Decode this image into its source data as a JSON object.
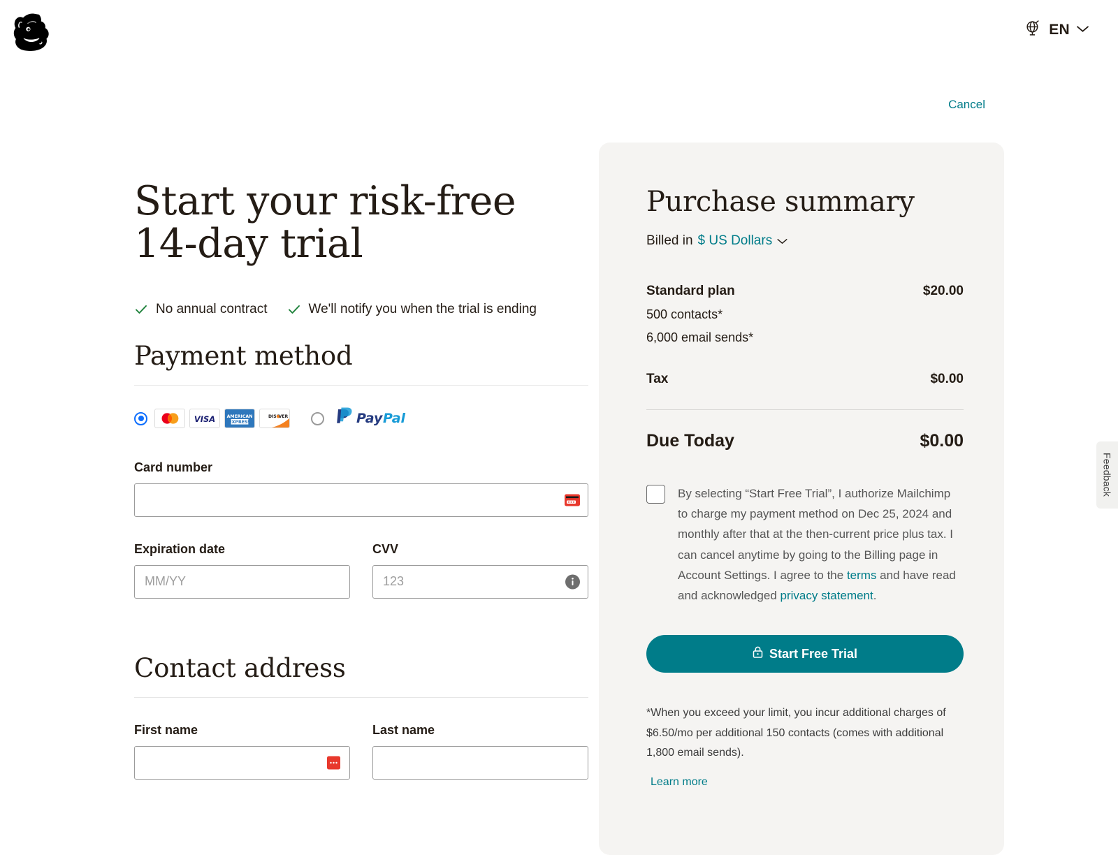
{
  "header": {
    "logo_alt": "Mailchimp",
    "language_code": "EN",
    "cancel_label": "Cancel"
  },
  "left": {
    "headline_line1": "Start your risk-free",
    "headline_line2": "14-day trial",
    "benefits": [
      "No annual contract",
      "We'll notify you when the trial is ending"
    ],
    "payment_section_title": "Payment method",
    "methods": {
      "card_selected": true,
      "card_brands": [
        "mastercard",
        "visa",
        "american-express",
        "discover"
      ],
      "paypal_label_1": "Pay",
      "paypal_label_2": "Pal"
    },
    "card_number_label": "Card number",
    "card_number_value": "",
    "card_number_placeholder": "",
    "expiration_label": "Expiration date",
    "expiration_placeholder": "MM/YY",
    "expiration_value": "",
    "cvv_label": "CVV",
    "cvv_placeholder": "123",
    "cvv_value": "",
    "contact_section_title": "Contact address",
    "first_name_label": "First name",
    "first_name_value": "",
    "last_name_label": "Last name",
    "last_name_value": ""
  },
  "summary": {
    "title": "Purchase summary",
    "billed_in_label": "Billed in",
    "currency": "$ US Dollars",
    "plan_name": "Standard plan",
    "plan_price": "$20.00",
    "plan_details": [
      "500 contacts*",
      "6,000 email sends*"
    ],
    "tax_label": "Tax",
    "tax_amount": "$0.00",
    "due_label": "Due Today",
    "due_amount": "$0.00",
    "consent": {
      "checked": false,
      "text_part_1": "By selecting “Start Free Trial”, I authorize Mailchimp to charge my payment method on Dec 25, 2024 and monthly after that at the then-current price plus tax. I can cancel anytime by going to the Billing page in Account Settings. I agree to the ",
      "terms_link": "terms",
      "text_part_2": " and have read and acknowledged ",
      "privacy_link": "privacy statement",
      "text_part_3": "."
    },
    "cta_label": "Start Free Trial",
    "footnote": "*When you exceed your limit, you incur additional charges of $6.50/mo per additional 150 contacts (comes with additional 1,800 email sends).",
    "learn_more_label": "Learn more"
  },
  "feedback": {
    "label": "Feedback"
  },
  "colors": {
    "accent_teal": "#007c89",
    "panel_bg": "#f5f4f2",
    "check_green": "#1a7f37",
    "text": "#241c15"
  }
}
